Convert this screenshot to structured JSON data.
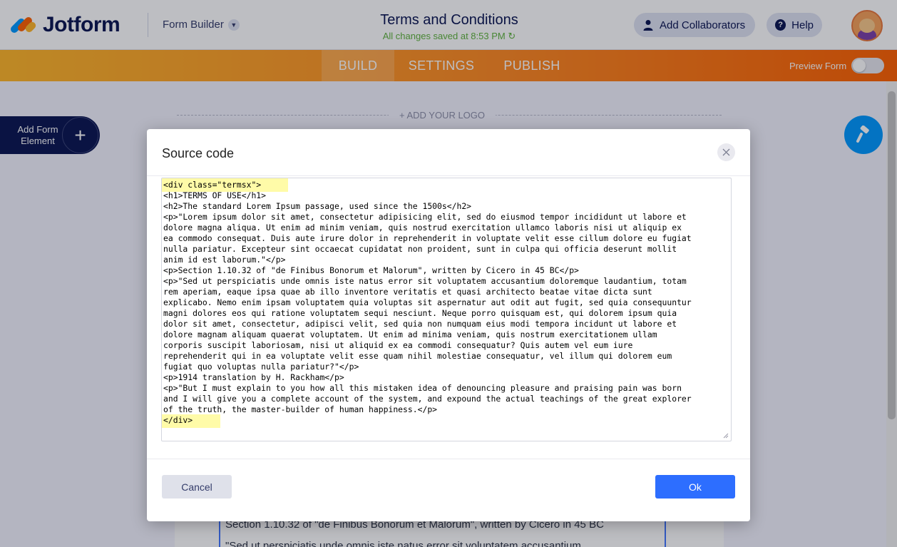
{
  "app": {
    "logo_text": "Jotform",
    "builder_label": "Form Builder",
    "form_title": "Terms and Conditions",
    "saved_status": "All changes saved at 8:53 PM",
    "add_collaborators_label": "Add Collaborators",
    "help_label": "Help",
    "preview_label": "Preview Form",
    "preview_enabled": false
  },
  "tabs": [
    {
      "label": "BUILD",
      "active": true
    },
    {
      "label": "SETTINGS",
      "active": false
    },
    {
      "label": "PUBLISH",
      "active": false
    }
  ],
  "canvas": {
    "add_logo_label": "+ ADD YOUR LOGO",
    "add_element_label": "Add Form Element",
    "add_element_line1": "Add Form",
    "add_element_line2": "Element",
    "visible_text": [
      "Section 1.10.32 of \"de Finibus Bonorum et Malorum\", written by Cicero in 45 BC",
      "\"Sed ut perspiciatis unde omnis iste natus error sit voluptatem accusantium"
    ]
  },
  "modal": {
    "title": "Source code",
    "code_lines": [
      "<div class=\"termsx\">",
      "<h1>TERMS OF USE</h1>",
      "<h2>The standard Lorem Ipsum passage, used since the 1500s</h2>",
      "<p>\"Lorem ipsum dolor sit amet, consectetur adipisicing elit, sed do eiusmod tempor incididunt ut labore et",
      "dolore magna aliqua. Ut enim ad minim veniam, quis nostrud exercitation ullamco laboris nisi ut aliquip ex",
      "ea commodo consequat. Duis aute irure dolor in reprehenderit in voluptate velit esse cillum dolore eu fugiat",
      "nulla pariatur. Excepteur sint occaecat cupidatat non proident, sunt in culpa qui officia deserunt mollit",
      "anim id est laborum.\"</p>",
      "<p>Section 1.10.32 of \"de Finibus Bonorum et Malorum\", written by Cicero in 45 BC</p>",
      "<p>\"Sed ut perspiciatis unde omnis iste natus error sit voluptatem accusantium doloremque laudantium, totam",
      "rem aperiam, eaque ipsa quae ab illo inventore veritatis et quasi architecto beatae vitae dicta sunt",
      "explicabo. Nemo enim ipsam voluptatem quia voluptas sit aspernatur aut odit aut fugit, sed quia consequuntur",
      "magni dolores eos qui ratione voluptatem sequi nesciunt. Neque porro quisquam est, qui dolorem ipsum quia",
      "dolor sit amet, consectetur, adipisci velit, sed quia non numquam eius modi tempora incidunt ut labore et",
      "dolore magnam aliquam quaerat voluptatem. Ut enim ad minima veniam, quis nostrum exercitationem ullam",
      "corporis suscipit laboriosam, nisi ut aliquid ex ea commodi consequatur? Quis autem vel eum iure",
      "reprehenderit qui in ea voluptate velit esse quam nihil molestiae consequatur, vel illum qui dolorem eum",
      "fugiat quo voluptas nulla pariatur?\"</p>",
      "<p>1914 translation by H. Rackham</p>",
      "<p>\"But I must explain to you how all this mistaken idea of denouncing pleasure and praising pain was born",
      "and I will give you a complete account of the system, and expound the actual teachings of the great explorer",
      "of the truth, the master-builder of human happiness.</p>",
      "</div>"
    ],
    "cancel_label": "Cancel",
    "ok_label": "Ok"
  },
  "colors": {
    "brand_navy": "#0a1551",
    "brand_orange": "#ff6100",
    "accent_blue": "#2d6eff",
    "saved_green": "#5fb33d",
    "highlight_yellow": "#fffba8"
  },
  "icons": {
    "builder_switch": "chevron-down-icon",
    "saved": "refresh-icon",
    "collaborators": "user-icon",
    "help": "question-icon",
    "add_element": "plus-icon",
    "designer": "paint-roller-icon",
    "close": "close-icon"
  }
}
